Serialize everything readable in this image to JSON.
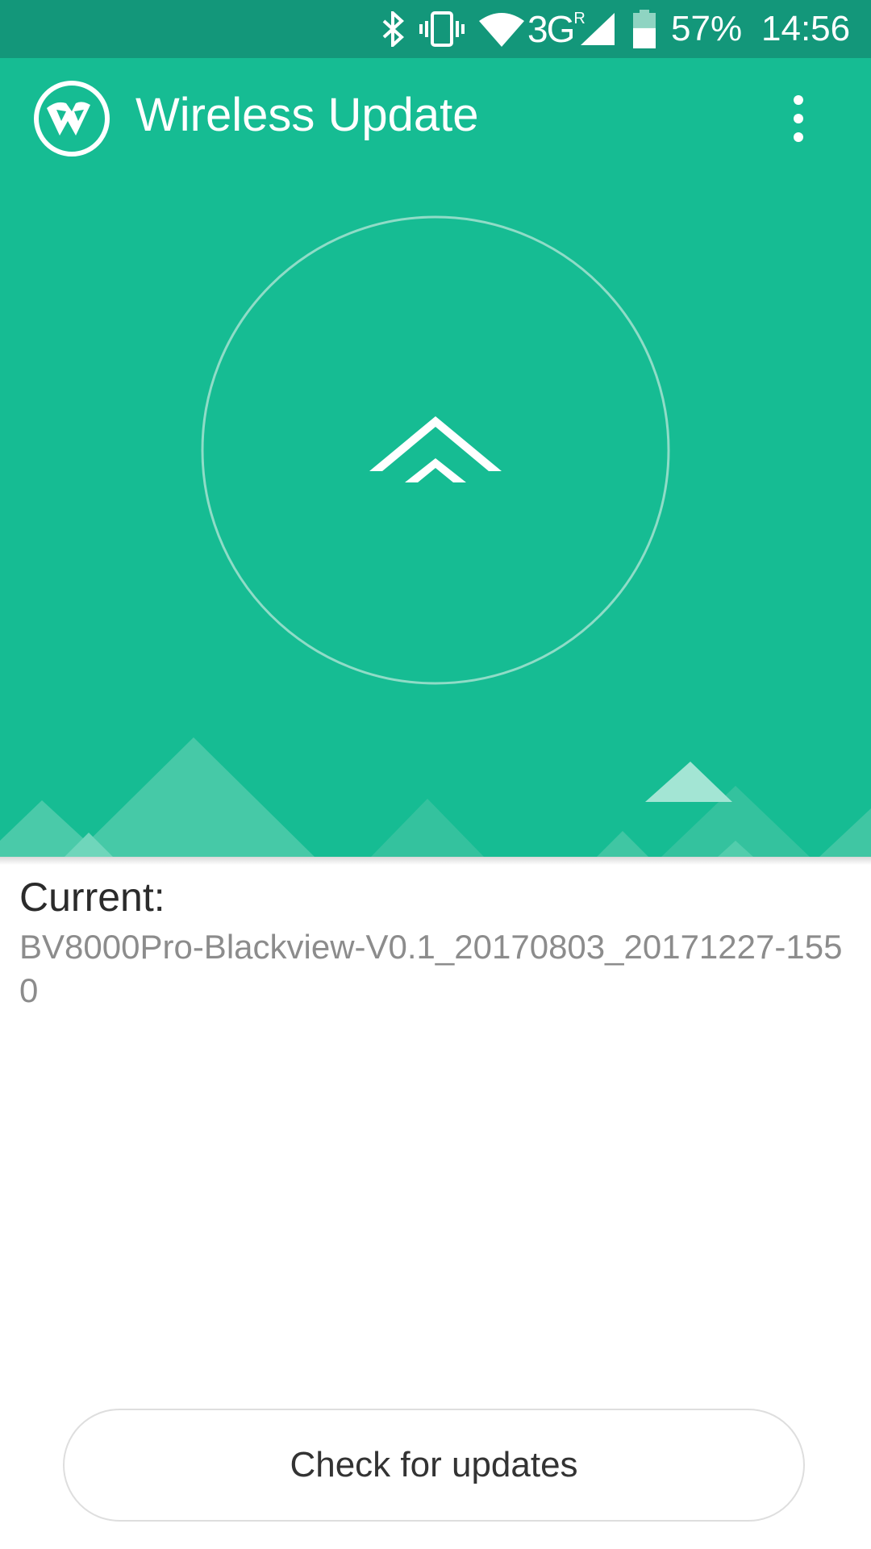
{
  "status_bar": {
    "network_type": "3G",
    "roaming_indicator": "R",
    "battery_percent": "57%",
    "time": "14:56",
    "icons": [
      "bluetooth-icon",
      "vibrate-icon",
      "wifi-icon",
      "signal-icon",
      "battery-icon"
    ],
    "battery_level": 0.57
  },
  "app_bar": {
    "title": "Wireless Update",
    "logo_icon": "wireless-update-logo",
    "menu_icon": "more-vert-icon"
  },
  "hero": {
    "action_icon": "double-chevron-up-icon",
    "colors": {
      "background": "#16bc93",
      "status_bar": "#13977a"
    }
  },
  "version_info": {
    "label": "Current:",
    "value": "BV8000Pro-Blackview-V0.1_20170803_20171227-1550"
  },
  "actions": {
    "check_updates_label": "Check for updates"
  }
}
